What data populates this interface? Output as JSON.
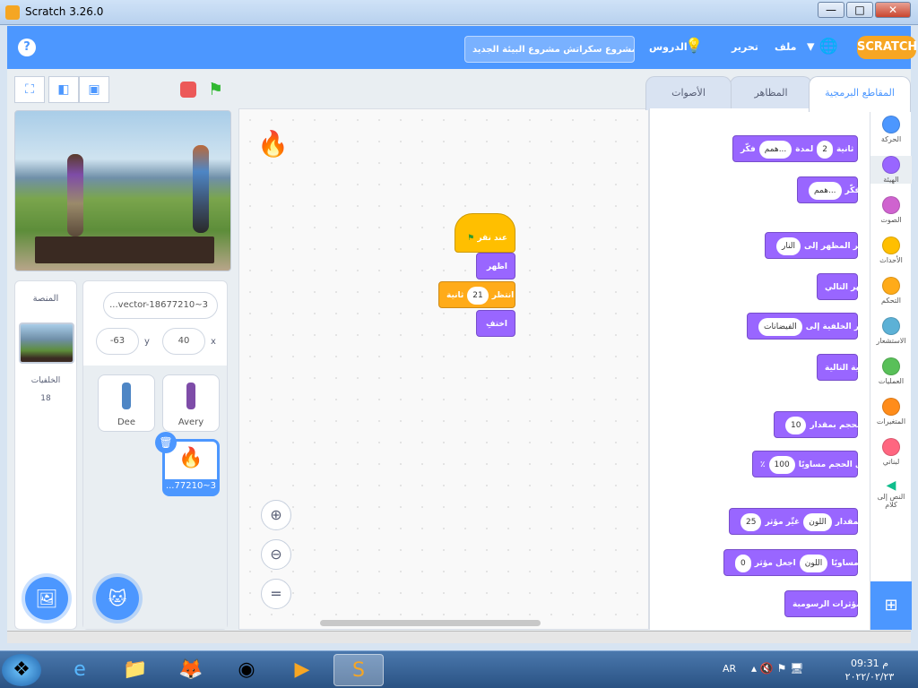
{
  "window": {
    "title": "Scratch 3.26.0",
    "minimize": "—",
    "maximize": "□",
    "close": "✕"
  },
  "menu": {
    "file": "ملف",
    "edit": "تحرير",
    "tutorials": "الدروس",
    "project_title": "مشروع سكراتش مشروع البيئة الجديد",
    "logo": "SCRATCH",
    "help": "?"
  },
  "tabs": {
    "code": "المقاطع البرمجية",
    "costumes": "المظاهر",
    "sounds": "الأصوات"
  },
  "stage_panel": {
    "label": "المنصة",
    "backdrops_label": "الخلفيات",
    "backdrops_count": "18"
  },
  "sprite_info": {
    "name": "vector-18677210~3...",
    "x_label": "x",
    "x": "40",
    "y_label": "y",
    "y": "-63"
  },
  "sprites": [
    {
      "name": "Avery"
    },
    {
      "name": "Dee"
    },
    {
      "name": "...77210~3"
    }
  ],
  "categories": [
    {
      "label": "الحركة",
      "color": "#4c97ff"
    },
    {
      "label": "الهيئة",
      "color": "#9966ff"
    },
    {
      "label": "الصوت",
      "color": "#cf63cf"
    },
    {
      "label": "الأحداث",
      "color": "#ffbf00"
    },
    {
      "label": "التحكم",
      "color": "#ffab19"
    },
    {
      "label": "الاستشعار",
      "color": "#5cb1d6"
    },
    {
      "label": "العمليات",
      "color": "#59c059"
    },
    {
      "label": "المتغيرات",
      "color": "#ff8c1a"
    },
    {
      "label": "لبناتي",
      "color": "#ff6680"
    },
    {
      "label": "النص إلى كلام",
      "color": "#0fbd8c"
    }
  ],
  "palette": {
    "think_for": {
      "verb": "فكّر",
      "value": "همم...",
      "mid": "لمدة",
      "secs": "2",
      "unit": "ثانية"
    },
    "think": {
      "verb": "فكّر",
      "value": "همم..."
    },
    "switch_costume": {
      "verb": "غيِّر المظهر إلى",
      "value": "النار"
    },
    "next_costume": "المظهر التالي",
    "switch_backdrop": {
      "verb": "غيِّر الخلفية إلى",
      "value": "الفيضانات"
    },
    "next_backdrop": "الخلفية التالية",
    "change_size": {
      "verb": "غيِّر الحجم بمقدار",
      "value": "10"
    },
    "set_size": {
      "verb": "اجعل الحجم مساويًا",
      "value": "100",
      "unit": "٪"
    },
    "change_effect": {
      "verb": "غيِّر مؤثر",
      "effect": "اللون",
      "mid": "بمقدار",
      "value": "25"
    },
    "set_effect": {
      "verb": "اجعل مؤثر",
      "effect": "اللون",
      "mid": "مساويًا",
      "value": "0"
    },
    "clear_effects": "أزل المؤثرات الرسومية"
  },
  "script": {
    "hat": "عند نقر",
    "show": "اظهر",
    "wait": "انتظر",
    "wait_value": "21",
    "wait_unit": "ثانية",
    "hide": "اختفِ"
  },
  "taskbar": {
    "lang": "AR",
    "time": "09:31 م",
    "date": "٢٠٢٢/٠٢/٢٣"
  }
}
